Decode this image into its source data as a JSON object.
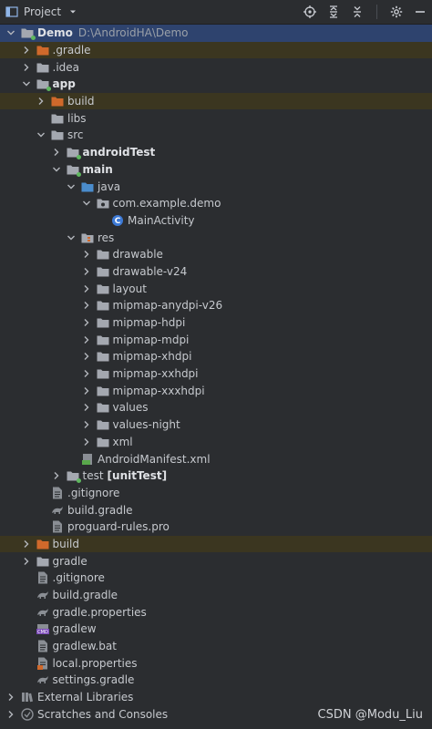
{
  "toolbar": {
    "title": "Project",
    "icons": [
      "select-opened-file-icon",
      "expand-all-icon",
      "collapse-all-icon",
      "settings-icon",
      "hide-icon"
    ]
  },
  "tree": [
    {
      "name": "Demo",
      "path": "D:\\AndroidHA\\Demo",
      "level": 0,
      "type": "module",
      "expanded": true,
      "bold": true,
      "selected": true
    },
    {
      "name": ".gradle",
      "level": 1,
      "type": "folder-orange",
      "expanded": false,
      "excluded": true
    },
    {
      "name": ".idea",
      "level": 1,
      "type": "folder",
      "expanded": false
    },
    {
      "name": "app",
      "level": 1,
      "type": "module",
      "expanded": true,
      "bold": true
    },
    {
      "name": "build",
      "level": 2,
      "type": "folder-orange",
      "expanded": false,
      "excluded": true
    },
    {
      "name": "libs",
      "level": 2,
      "type": "folder",
      "expanded": null
    },
    {
      "name": "src",
      "level": 2,
      "type": "folder",
      "expanded": true
    },
    {
      "name": "androidTest",
      "level": 3,
      "type": "folder-module",
      "expanded": false,
      "bold": true
    },
    {
      "name": "main",
      "level": 3,
      "type": "folder-module",
      "expanded": true,
      "bold": true
    },
    {
      "name": "java",
      "level": 4,
      "type": "folder-blue",
      "expanded": true
    },
    {
      "name": "com.example.demo",
      "level": 5,
      "type": "package",
      "expanded": true
    },
    {
      "name": "MainActivity",
      "level": 6,
      "type": "class",
      "expanded": null
    },
    {
      "name": "res",
      "level": 4,
      "type": "folder-res",
      "expanded": true
    },
    {
      "name": "drawable",
      "level": 5,
      "type": "folder",
      "expanded": false
    },
    {
      "name": "drawable-v24",
      "level": 5,
      "type": "folder",
      "expanded": false
    },
    {
      "name": "layout",
      "level": 5,
      "type": "folder",
      "expanded": false
    },
    {
      "name": "mipmap-anydpi-v26",
      "level": 5,
      "type": "folder",
      "expanded": false
    },
    {
      "name": "mipmap-hdpi",
      "level": 5,
      "type": "folder",
      "expanded": false
    },
    {
      "name": "mipmap-mdpi",
      "level": 5,
      "type": "folder",
      "expanded": false
    },
    {
      "name": "mipmap-xhdpi",
      "level": 5,
      "type": "folder",
      "expanded": false
    },
    {
      "name": "mipmap-xxhdpi",
      "level": 5,
      "type": "folder",
      "expanded": false
    },
    {
      "name": "mipmap-xxxhdpi",
      "level": 5,
      "type": "folder",
      "expanded": false
    },
    {
      "name": "values",
      "level": 5,
      "type": "folder",
      "expanded": false
    },
    {
      "name": "values-night",
      "level": 5,
      "type": "folder",
      "expanded": false
    },
    {
      "name": "xml",
      "level": 5,
      "type": "folder",
      "expanded": false
    },
    {
      "name": "AndroidManifest.xml",
      "level": 4,
      "type": "manifest",
      "expanded": null
    },
    {
      "name": "test",
      "suffix": "[unitTest]",
      "level": 3,
      "type": "folder-module",
      "expanded": false
    },
    {
      "name": ".gitignore",
      "level": 2,
      "type": "file",
      "expanded": null
    },
    {
      "name": "build.gradle",
      "level": 2,
      "type": "gradle",
      "expanded": null
    },
    {
      "name": "proguard-rules.pro",
      "level": 2,
      "type": "file",
      "expanded": null
    },
    {
      "name": "build",
      "level": 1,
      "type": "folder-orange",
      "expanded": false,
      "excluded": true
    },
    {
      "name": "gradle",
      "level": 1,
      "type": "folder",
      "expanded": false
    },
    {
      "name": ".gitignore",
      "level": 1,
      "type": "file",
      "expanded": null
    },
    {
      "name": "build.gradle",
      "level": 1,
      "type": "gradle",
      "expanded": null
    },
    {
      "name": "gradle.properties",
      "level": 1,
      "type": "gradle",
      "expanded": null
    },
    {
      "name": "gradlew",
      "level": 1,
      "type": "cmd",
      "expanded": null
    },
    {
      "name": "gradlew.bat",
      "level": 1,
      "type": "file",
      "expanded": null
    },
    {
      "name": "local.properties",
      "level": 1,
      "type": "properties",
      "expanded": null
    },
    {
      "name": "settings.gradle",
      "level": 1,
      "type": "gradle",
      "expanded": null
    },
    {
      "name": "External Libraries",
      "level": 0,
      "type": "libraries",
      "expanded": false
    },
    {
      "name": "Scratches and Consoles",
      "level": 0,
      "type": "scratches",
      "expanded": false
    }
  ],
  "watermark": "CSDN @Modu_Liu",
  "colors": {
    "background": "#2b2d30",
    "selection": "#2e436e",
    "excluded": "#3b3620",
    "folder": "#a4a8b0",
    "folder_orange": "#d0692b",
    "folder_blue": "#4a8ccc",
    "module_dot": "#5fb85f"
  }
}
